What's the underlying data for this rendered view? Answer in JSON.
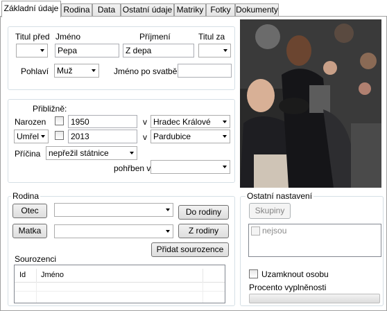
{
  "tabs": [
    "Základní údaje",
    "Rodina",
    "Data",
    "Ostatní údaje",
    "Matriky",
    "Fotky",
    "Dokumenty"
  ],
  "identity": {
    "titul_pred_label": "Titul před",
    "jmeno_label": "Jméno",
    "prijmeni_label": "Příjmení",
    "titul_za_label": "Titul za",
    "titul_pred_value": "",
    "jmeno_value": "Pepa",
    "prijmeni_value": "Z depa",
    "titul_za_value": "",
    "pohlavi_label": "Pohlaví",
    "pohlavi_value": "Muž",
    "jmeno_po_svatbe_label": "Jméno po svatbě",
    "jmeno_po_svatbe_value": ""
  },
  "life": {
    "priblizne_label": "Přibližně:",
    "narozen_label": "Narozen",
    "narozen_year": "1950",
    "narozen_v_label": "v",
    "narozen_place": "Hradec Králové",
    "umrel_value": "Umřel",
    "umrel_year": "2013",
    "umrel_v_label": "v",
    "umrel_place": "Pardubice",
    "pricina_label": "Příčina",
    "pricina_value": "nepřežil státnice",
    "pohrben_label": "pohřben v",
    "pohrben_value": ""
  },
  "family": {
    "group_title": "Rodina",
    "otec_button": "Otec",
    "otec_value": "",
    "do_rodiny_button": "Do rodiny",
    "matka_button": "Matka",
    "matka_value": "",
    "z_rodiny_button": "Z rodiny",
    "pridat_sourozence_button": "Přidat sourozence",
    "sourozenci_label": "Sourozenci",
    "columns": [
      "Id",
      "Jméno"
    ]
  },
  "other": {
    "group_title": "Ostatní nastavení",
    "skupiny_button": "Skupiny",
    "nejsou_label": "nejsou",
    "uzamknout_label": "Uzamknout osobu",
    "procento_label": "Procento vyplněnosti",
    "procento_value": 0
  }
}
